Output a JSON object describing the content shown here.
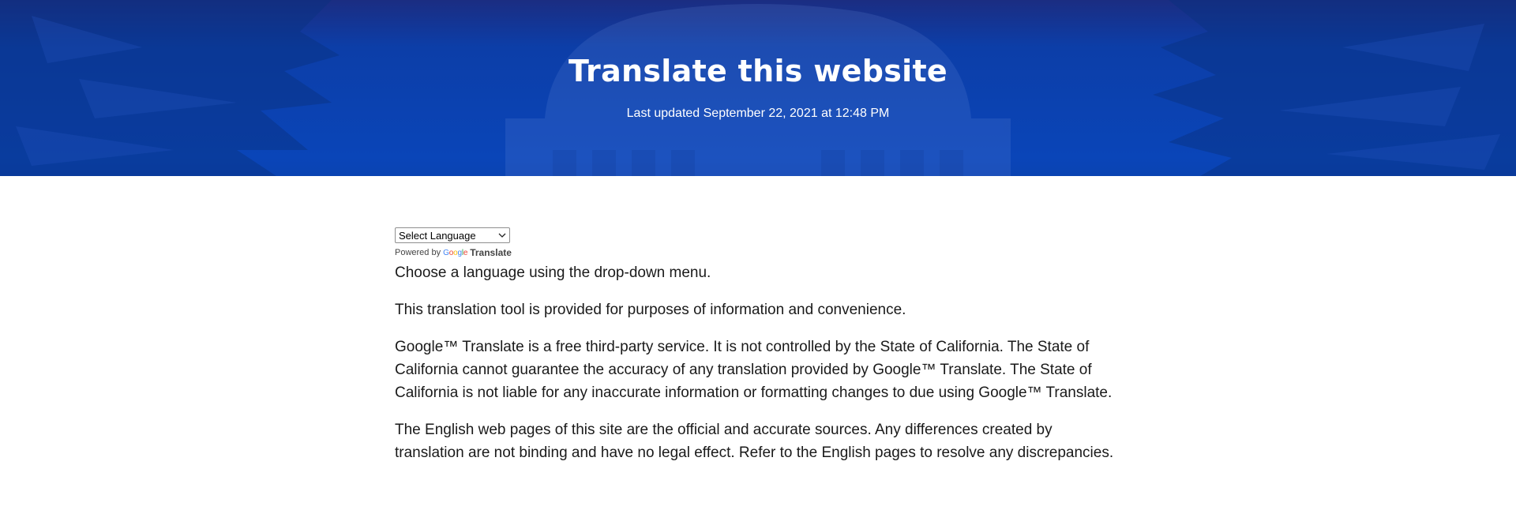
{
  "hero": {
    "title": "Translate this website",
    "last_updated": "Last updated September 22, 2021 at 12:48 PM",
    "background_color": "#0a43b2"
  },
  "language_selector": {
    "selected": "Select Language",
    "powered_by": "Powered by",
    "provider_logo": "Google",
    "provider_link": "Translate"
  },
  "content": {
    "paragraphs": [
      "Choose a language using the drop-down menu.",
      "This translation tool is provided for purposes of information and convenience.",
      "Google™ Translate is a free third-party service. It is not controlled by the State of California. The State of California cannot guarantee the accuracy of any translation provided by Google™ Translate. The State of California is not liable for any inaccurate information or formatting changes to due using Google™ Translate.",
      "The English web pages of this site are the official and accurate sources. Any differences created by translation are not binding and have no legal effect. Refer to the English pages to resolve any discrepancies."
    ]
  }
}
